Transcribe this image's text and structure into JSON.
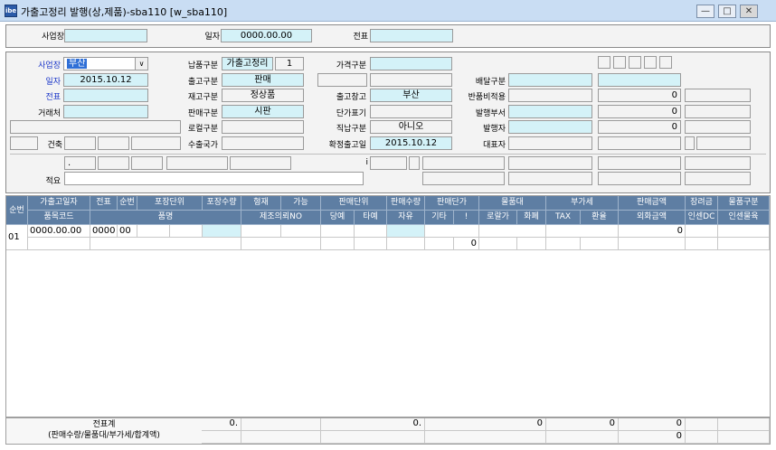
{
  "window": {
    "title": "가출고정리 발행(상,제품)-sba110 [w_sba110]",
    "icon_text": "ibe",
    "btn_min": "—",
    "btn_max": "□",
    "btn_close": "✕"
  },
  "search": {
    "site_label": "사업장",
    "date_label": "일자",
    "date_value": "0000.00.00",
    "slip_label": "전표"
  },
  "form": {
    "site_label": "사업장",
    "site_value": "부산",
    "date_label": "일자",
    "date_value": "2015.10.12",
    "slip_label": "전표",
    "customer_label": "거래처",
    "building_label": "건축",
    "note_label": "적요",
    "dot_value": ".",
    "payment_label": "납품구분",
    "payment_value": "가출고정리",
    "payment_code": "1",
    "release_label": "출고구분",
    "release_value": "판매",
    "stock_label": "재고구분",
    "stock_value": "정상품",
    "sales_label": "판매구분",
    "sales_value": "시판",
    "local_label": "로컬구분",
    "export_label": "수출국가",
    "price_label": "가격구분",
    "warehouse_label": "출고창고",
    "warehouse_value": "부산",
    "unitprice_label": "단가표기",
    "direct_label": "직납구분",
    "direct_value": "아니오",
    "confirm_label": "확정출고일",
    "confirm_value": "2015.10.12",
    "i_marker": "i",
    "delivery_label": "배달구분",
    "return_label": "반품비적용",
    "return_value": "0",
    "issue_dept_label": "발행부서",
    "issue_dept_value": "0",
    "issuer_label": "발행자",
    "issuer_value": "0",
    "rep_label": "대표자"
  },
  "grid": {
    "headers_top": [
      "순번",
      "가출고일자",
      "전표",
      "순번",
      "포장단위",
      "포장수량",
      "형재",
      "가능",
      "판매단위",
      "판매수량",
      "판매단가",
      "물품대",
      "부가세",
      "판매금액",
      "장려금",
      "물품구분"
    ],
    "headers_bottom": [
      "품목코드",
      "품명",
      "제조의뢰NO",
      "당예",
      "타예",
      "자유",
      "기타",
      "!",
      "로랄가",
      "화폐",
      "TAX",
      "환율",
      "외화금액",
      "인센DC",
      "인센물육"
    ],
    "rows": [
      {
        "seq": "01",
        "date": "0000.00.00",
        "slip": "0000",
        "no": "00",
        "sale_amount": "0",
        "price_other": "0"
      }
    ]
  },
  "footer": {
    "label_line1": "전표계",
    "label_line2": "(판매수량/물품대/부가세/합계액)",
    "qty1": "0.",
    "qty2": "0.",
    "goods": "0",
    "vat": "0",
    "total": "0",
    "total2": "0"
  }
}
